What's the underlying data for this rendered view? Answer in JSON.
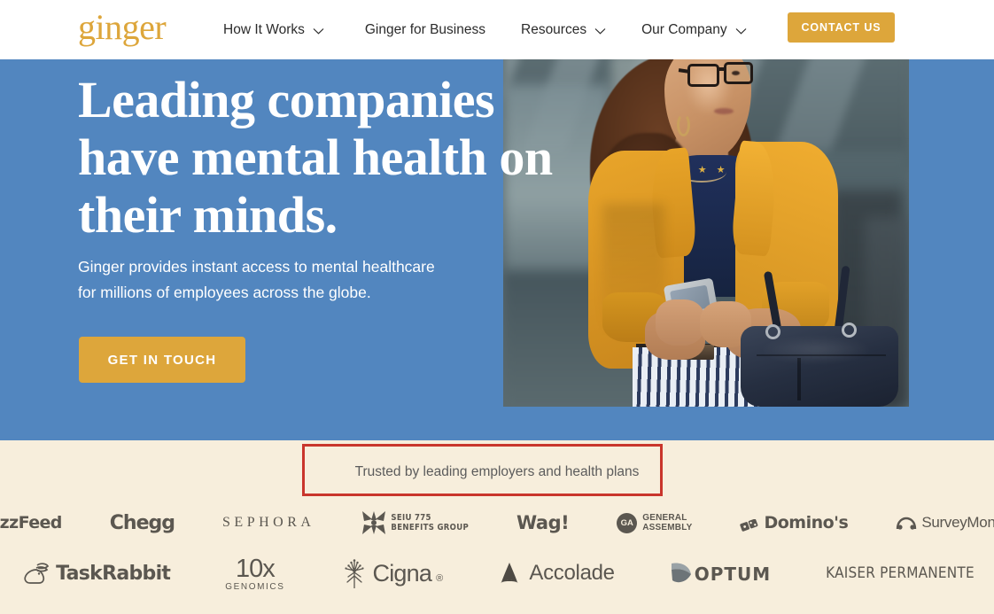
{
  "colors": {
    "brand_gold": "#DDA63B",
    "hero_blue": "#5286BF",
    "band_cream": "#F7EEDC",
    "annotation_red": "#C9352C",
    "logo_gray": "#5B5750"
  },
  "nav": {
    "brand": "ginger",
    "items": [
      {
        "label": "How It Works",
        "has_chevron": true,
        "icon": "chevron-down-icon"
      },
      {
        "label": "Ginger for Business",
        "has_chevron": false,
        "icon": ""
      },
      {
        "label": "Resources",
        "has_chevron": true,
        "icon": "chevron-down-icon"
      },
      {
        "label": "Our Company",
        "has_chevron": true,
        "icon": "chevron-down-icon"
      }
    ],
    "cta": "CONTACT US"
  },
  "hero": {
    "heading_line1": "Leading companies",
    "heading_line2": "have mental health on",
    "heading_line3": "their minds.",
    "subtext_line1": "Ginger provides instant access to mental healthcare",
    "subtext_line2": "for millions of employees across the globe.",
    "cta": "GET IN TOUCH",
    "image_alt": "woman-with-phone-photo"
  },
  "trust_band": {
    "title": "Trusted by leading employers and health plans",
    "logos_row1": [
      {
        "name": "BuzzFeed",
        "text_main": "Buzz",
        "text_alt": "F",
        "text_tail": "ee",
        "text_end": "D"
      },
      {
        "name": "Chegg",
        "text": "Chegg"
      },
      {
        "name": "SEPHORA",
        "text": "SEPHORA"
      },
      {
        "name": "SEIU 775 Benefits Group",
        "line1": "SEIU 775",
        "line2": "BENEFITS GROUP"
      },
      {
        "name": "Wag!",
        "text": "Wag!"
      },
      {
        "name": "General Assembly",
        "mark": "GA",
        "line1": "GENERAL",
        "line2": "ASSEMBLY"
      },
      {
        "name": "Domino's",
        "text": "Domino's"
      },
      {
        "name": "SurveyMonkey",
        "text": "SurveyMonkey"
      }
    ],
    "logos_row2": [
      {
        "name": "TaskRabbit",
        "text": "TaskRabbit"
      },
      {
        "name": "10x Genomics",
        "line1": "10x",
        "line2": "GENOMICS"
      },
      {
        "name": "Cigna",
        "text": "Cigna",
        "reg": "®"
      },
      {
        "name": "Accolade",
        "text": "Accolade"
      },
      {
        "name": "Optum",
        "text": "OPTUM"
      },
      {
        "name": "Kaiser Permanente",
        "text": "KAISER PERMANENTE"
      }
    ]
  },
  "annotation": {
    "type": "highlight-box",
    "target": "trust-band-title",
    "color": "#C9352C"
  }
}
